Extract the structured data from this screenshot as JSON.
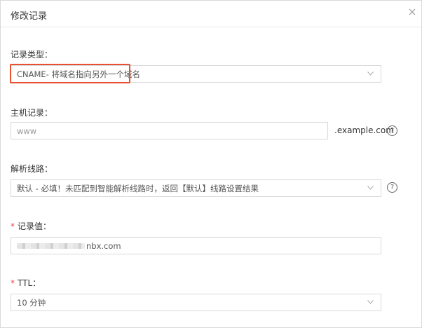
{
  "dialog": {
    "title": "修改记录"
  },
  "record_type": {
    "label": "记录类型：",
    "value": "CNAME- 将域名指向另外一个域名"
  },
  "host": {
    "label": "主机记录：",
    "placeholder": "www",
    "suffix": ".example.com",
    "help": "?"
  },
  "line": {
    "label": "解析线路：",
    "value": "默认 - 必填！未匹配到智能解析线路时，返回【默认】线路设置结果",
    "help": "?"
  },
  "record_value": {
    "required_mark": "*",
    "label": "记录值：",
    "value_visible": "nbx.com"
  },
  "ttl": {
    "required_mark": "*",
    "label": "TTL：",
    "value": "10 分钟"
  },
  "colors": {
    "highlight": "#e8502e",
    "required": "#e54545",
    "border": "#d9d9d9"
  }
}
